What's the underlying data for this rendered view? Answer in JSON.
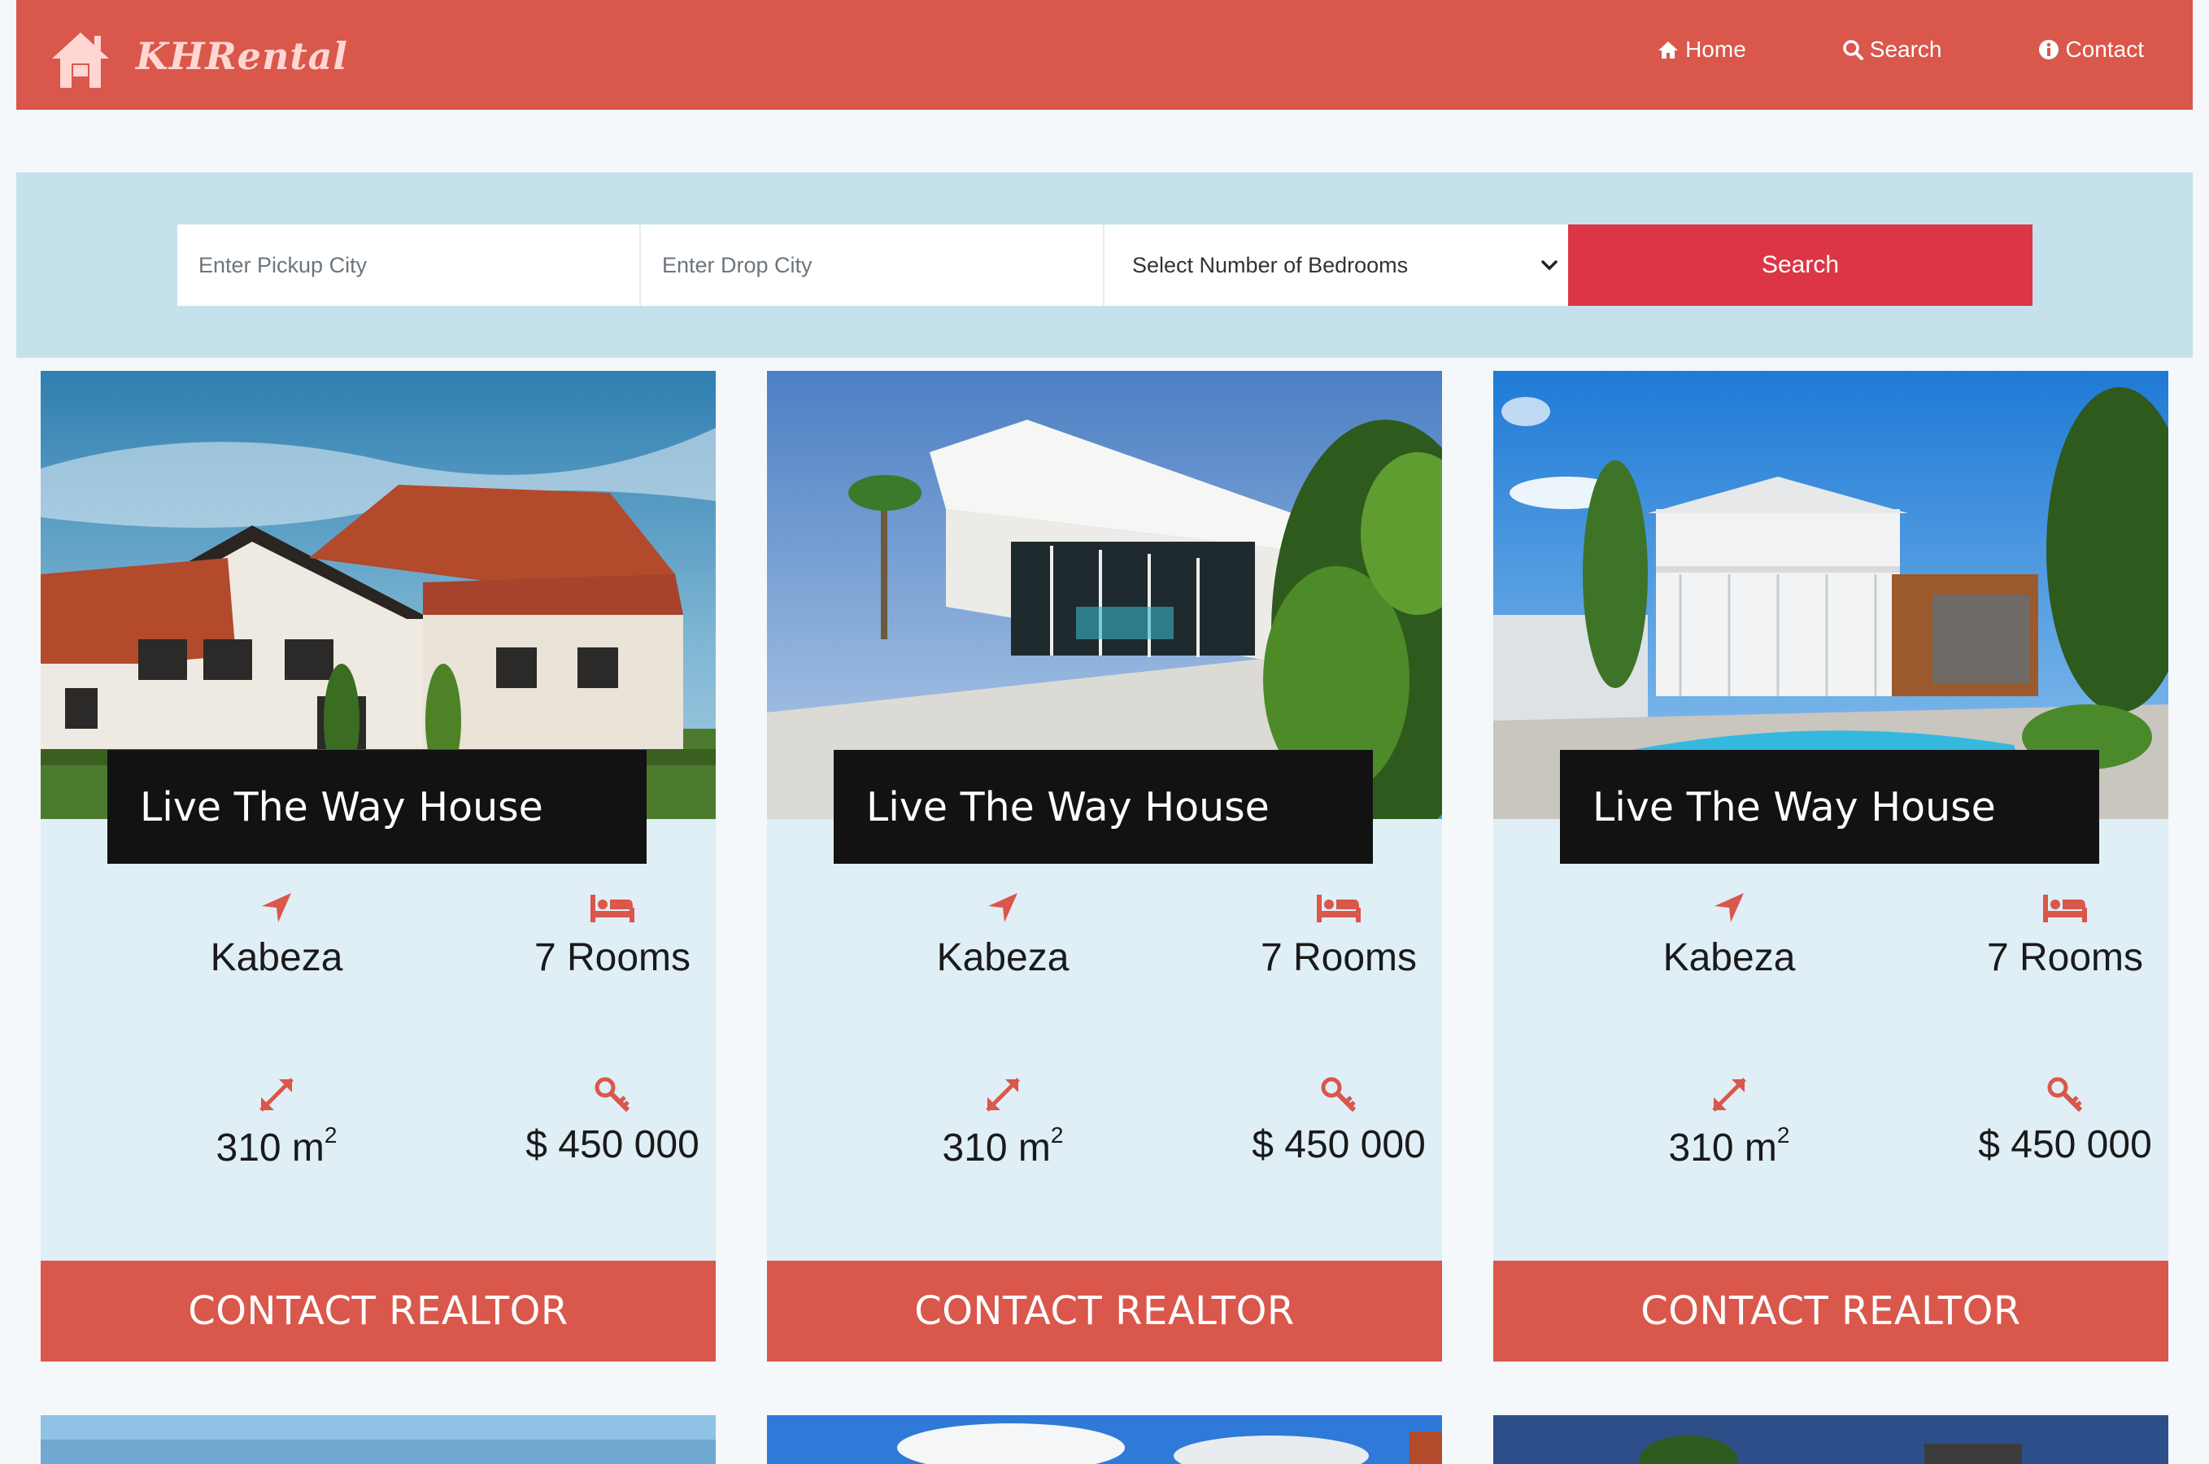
{
  "brand": {
    "name": "KHRental"
  },
  "nav": [
    {
      "label": "Home",
      "icon": "home-icon"
    },
    {
      "label": "Search",
      "icon": "search-icon"
    },
    {
      "label": "Contact",
      "icon": "info-icon"
    }
  ],
  "search": {
    "pickup_placeholder": "Enter Pickup City",
    "drop_placeholder": "Enter Drop City",
    "bedrooms_selected": "Select Number of Bedrooms",
    "button_label": "Search"
  },
  "listings": [
    {
      "title": "Live The Way House",
      "location": "Kabeza",
      "rooms": "7 Rooms",
      "area": "310 m",
      "area_unit_sup": "2",
      "price": "$ 450 000",
      "cta": "CONTACT REALTOR"
    },
    {
      "title": "Live The Way House",
      "location": "Kabeza",
      "rooms": "7 Rooms",
      "area": "310 m",
      "area_unit_sup": "2",
      "price": "$ 450 000",
      "cta": "CONTACT REALTOR"
    },
    {
      "title": "Live The Way House",
      "location": "Kabeza",
      "rooms": "7 Rooms",
      "area": "310 m",
      "area_unit_sup": "2",
      "price": "$ 450 000",
      "cta": "CONTACT REALTOR"
    }
  ],
  "colors": {
    "accent": "#d9574b",
    "search_panel": "#c5e1ec",
    "card_bg": "#e0eef6",
    "search_button": "#dc3545",
    "title_bg": "#121212"
  }
}
